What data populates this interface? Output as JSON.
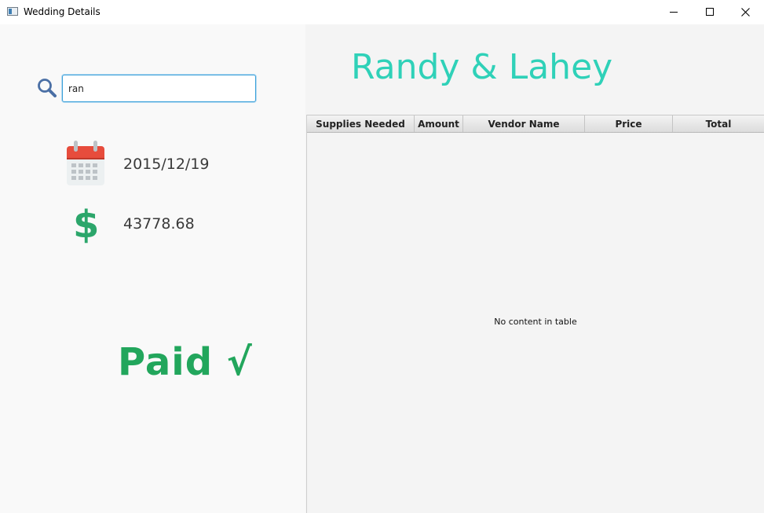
{
  "window": {
    "title": "Wedding Details"
  },
  "search": {
    "value": "ran"
  },
  "details": {
    "date": "2015/12/19",
    "amount": "43778.68",
    "paid_label": "Paid √"
  },
  "couple": {
    "title": "Randy & Lahey"
  },
  "table": {
    "columns": [
      "Supplies Needed",
      "Amount",
      "Vendor Name",
      "Price",
      "Total"
    ],
    "rows": [],
    "empty_message": "No content in table"
  },
  "icons": {
    "search": "search-icon",
    "calendar": "calendar-icon",
    "dollar": "dollar-icon"
  },
  "colors": {
    "title_accent": "#2fd1b8",
    "paid_green": "#22a65c",
    "dollar_green": "#2ca66b",
    "calendar_red": "#e74c3c",
    "focus_blue": "#3aa0d9"
  }
}
